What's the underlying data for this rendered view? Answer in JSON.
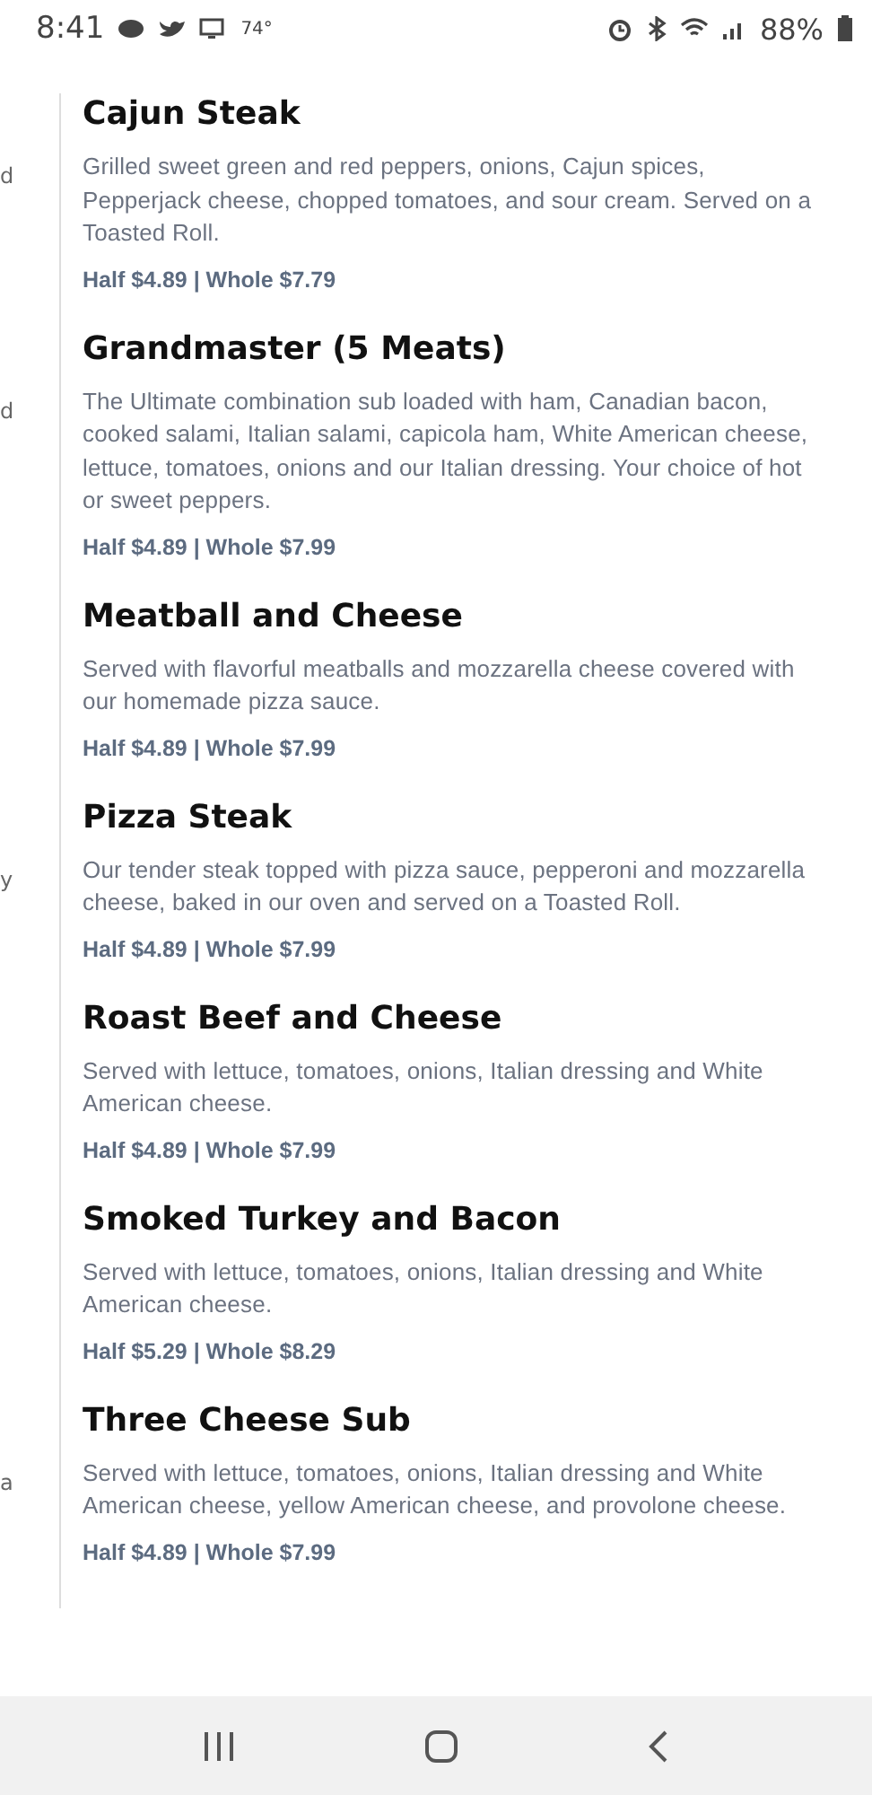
{
  "status_bar": {
    "time": "8:41",
    "temperature": "74°",
    "battery": "88%"
  },
  "items": [
    {
      "name": "Cajun Steak",
      "description": "Grilled sweet green and red peppers, onions, Cajun spices, Pepperjack cheese, chopped tomatoes, and sour cream. Served on a Toasted Roll.",
      "price": "Half $4.89 | Whole $7.79",
      "left_fragment": "d"
    },
    {
      "name": "Grandmaster (5 Meats)",
      "description": "The Ultimate combination sub loaded with ham, Canadian bacon, cooked salami, Italian salami, capicola ham, White American cheese, lettuce, tomatoes, onions and our Italian dressing. Your choice of hot or sweet peppers.",
      "price": "Half $4.89 | Whole $7.99",
      "left_fragment": "d"
    },
    {
      "name": "Meatball and Cheese",
      "description": "Served with flavorful meatballs and mozzarella cheese covered with our homemade pizza sauce.",
      "price": "Half $4.89 | Whole $7.99"
    },
    {
      "name": "Pizza Steak",
      "description": "Our tender steak topped with pizza sauce, pepperoni and mozzarella cheese, baked in our oven and served on a Toasted Roll.",
      "price": "Half $4.89 | Whole $7.99",
      "left_fragment": "y"
    },
    {
      "name": "Roast Beef and Cheese",
      "description": "Served with lettuce, tomatoes, onions, Italian dressing and White American cheese.",
      "price": "Half $4.89 | Whole $7.99"
    },
    {
      "name": "Smoked Turkey and Bacon",
      "description": "Served with lettuce, tomatoes, onions, Italian dressing and White American cheese.",
      "price": "Half $5.29 | Whole $8.29"
    },
    {
      "name": "Three Cheese Sub",
      "description": "Served with lettuce, tomatoes, onions, Italian dressing and White American cheese, yellow American cheese, and provolone cheese.",
      "price": "Half $4.89 | Whole $7.99",
      "left_fragment": "a"
    }
  ]
}
